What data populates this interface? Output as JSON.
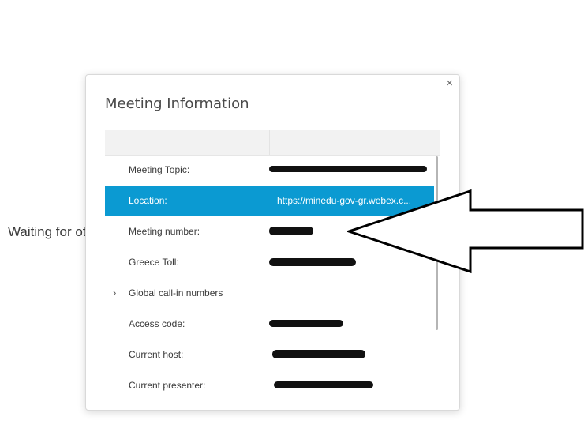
{
  "background": {
    "status_text": "Waiting for others to join"
  },
  "dialog": {
    "title": "Meeting Information",
    "close_glyph": "×",
    "rows": [
      {
        "label": "Meeting Topic:",
        "value": "",
        "redacted": true
      },
      {
        "label": "Location:",
        "value": "https://minedu-gov-gr.webex.c...",
        "selected": true
      },
      {
        "label": "Meeting number:",
        "value": "",
        "redacted": true
      },
      {
        "label": "Greece Toll:",
        "value": "",
        "redacted": true
      },
      {
        "label": "Global call-in numbers",
        "expandable": true
      },
      {
        "label": "Access code:",
        "value": "",
        "redacted": true
      },
      {
        "label": "Current host:",
        "value": "",
        "redacted": true
      },
      {
        "label": "Current presenter:",
        "value": "",
        "redacted": true
      }
    ]
  },
  "icons": {
    "close": "close-icon",
    "expand": "chevron-right-icon"
  },
  "colors": {
    "selected_row": "#0b9ad2",
    "header_bg": "#f2f2f2",
    "arrow_outline": "#000000"
  }
}
